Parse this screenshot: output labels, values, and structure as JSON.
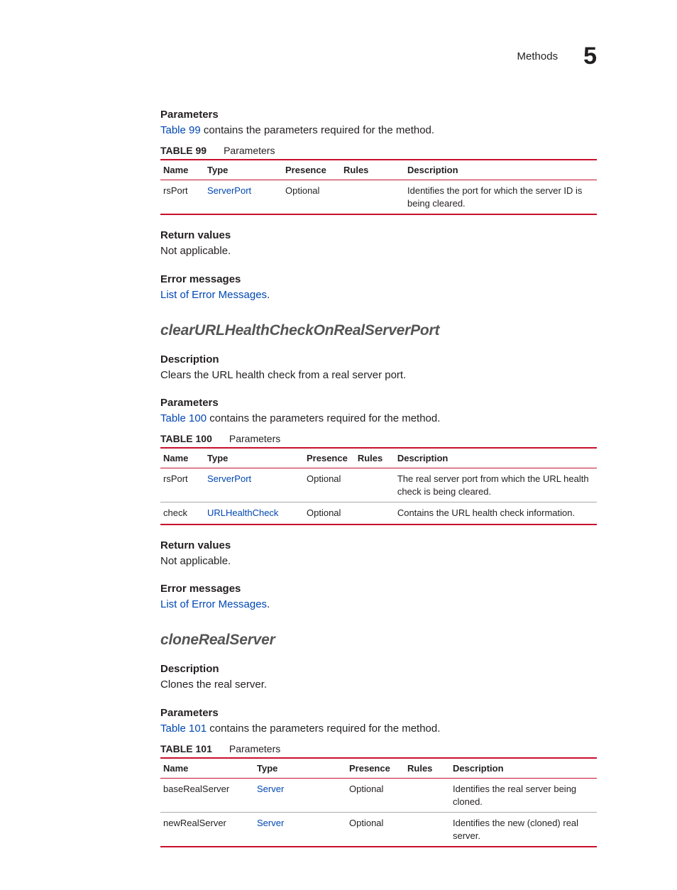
{
  "header": {
    "section": "Methods",
    "chapter": "5"
  },
  "tableHeaders": {
    "name": "Name",
    "type": "Type",
    "presence": "Presence",
    "rules": "Rules",
    "description": "Description"
  },
  "labels": {
    "parameters": "Parameters",
    "returnValues": "Return values",
    "errorMessages": "Error messages",
    "description": "Description",
    "captionSuffix": "Parameters"
  },
  "block0": {
    "paramsIntroPre": "Table 99",
    "paramsIntroPost": " contains the parameters required for the method.",
    "tableNumber": "TABLE 99",
    "rows": [
      {
        "name": "rsPort",
        "type": "ServerPort",
        "presence": "Optional",
        "rules": "",
        "description": "Identifies the port for which the server ID is being cleared."
      }
    ],
    "returnText": "Not applicable.",
    "errorLink": "List of Error Messages",
    "errorTail": "."
  },
  "method1": {
    "title": "clearURLHealthCheckOnRealServerPort",
    "descText": "Clears the URL health check from a real server port.",
    "paramsIntroPre": "Table 100",
    "paramsIntroPost": " contains the parameters required for the method.",
    "tableNumber": "TABLE 100",
    "rows": [
      {
        "name": "rsPort",
        "type": "ServerPort",
        "presence": "Optional",
        "rules": "",
        "description": "The real server port from which the URL health check is being cleared."
      },
      {
        "name": "check",
        "type": "URLHealthCheck",
        "presence": "Optional",
        "rules": "",
        "description": "Contains the URL health check information."
      }
    ],
    "returnText": "Not applicable.",
    "errorLink": "List of Error Messages",
    "errorTail": "."
  },
  "method2": {
    "title": "cloneRealServer",
    "descText": "Clones the real server.",
    "paramsIntroPre": "Table 101",
    "paramsIntroPost": " contains the parameters required for the method.",
    "tableNumber": "TABLE 101",
    "rows": [
      {
        "name": "baseRealServer",
        "type": "Server",
        "presence": "Optional",
        "rules": "",
        "description": "Identifies the real server being cloned."
      },
      {
        "name": "newRealServer",
        "type": "Server",
        "presence": "Optional",
        "rules": "",
        "description": "Identifies the new (cloned) real server."
      }
    ]
  },
  "colWidths": {
    "t99": [
      "62",
      "110",
      "82",
      "90",
      ""
    ],
    "t100": [
      "62",
      "140",
      "70",
      "56",
      ""
    ],
    "t101": [
      "132",
      "130",
      "82",
      "64",
      ""
    ]
  }
}
